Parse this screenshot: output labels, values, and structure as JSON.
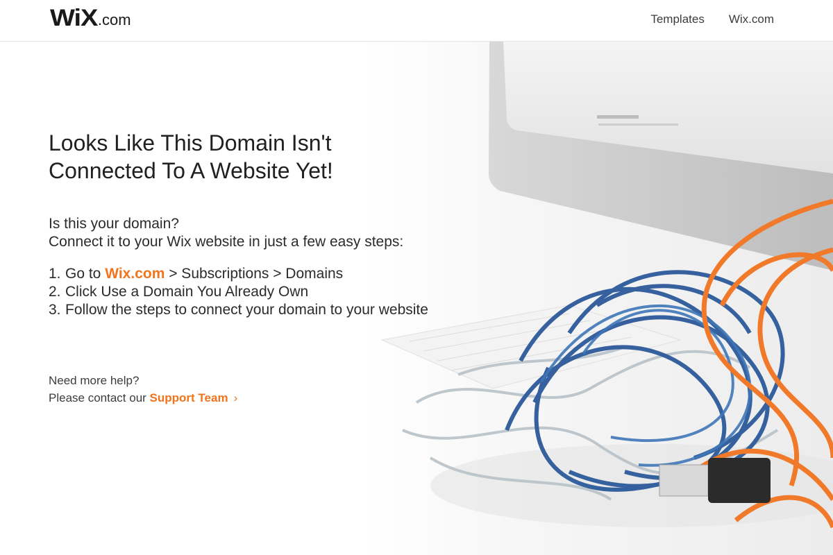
{
  "header": {
    "logo_wix": "WiX",
    "logo_com": ".com",
    "nav": [
      {
        "label": "Templates"
      },
      {
        "label": "Wix.com"
      }
    ]
  },
  "main": {
    "title_line1": "Looks Like This Domain Isn't",
    "title_line2": "Connected To A Website Yet!",
    "intro_line1": "Is this your domain?",
    "intro_line2": "Connect it to your Wix website in just a few easy steps:",
    "steps": [
      {
        "num": "1.",
        "prefix": "Go to ",
        "link": "Wix.com",
        "suffix": " > Subscriptions > Domains"
      },
      {
        "num": "2.",
        "text": "Click Use a Domain You Already Own"
      },
      {
        "num": "3.",
        "text": "Follow the steps to connect your domain to your website"
      }
    ]
  },
  "help": {
    "line1": "Need more help?",
    "line2_prefix": "Please contact our ",
    "link": "Support Team",
    "chevron": "›"
  },
  "colors": {
    "accent": "#f1741c",
    "text": "#202020"
  }
}
